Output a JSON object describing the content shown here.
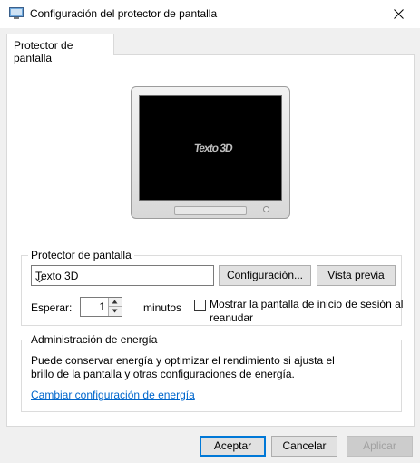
{
  "window": {
    "title": "Configuración del protector de pantalla"
  },
  "tabs": [
    {
      "label": "Protector de pantalla"
    }
  ],
  "preview": {
    "screen_text": "Texto 3D"
  },
  "screensaver_group": {
    "legend": "Protector de pantalla",
    "selected": "Texto 3D",
    "settings_label": "Configuración...",
    "preview_label": "Vista previa",
    "wait_label": "Esperar:",
    "wait_value": "1",
    "minutes_label": "minutos",
    "resume_checkbox_line1": "Mostrar la pantalla de inicio de sesión al",
    "resume_checkbox_line2": "reanudar",
    "resume_checked": false
  },
  "power_group": {
    "legend": "Administración de energía",
    "description_line1": "Puede conservar energía y optimizar el rendimiento si ajusta el",
    "description_line2": "brillo de la pantalla y otras configuraciones de energía.",
    "link_label": "Cambiar configuración de energía"
  },
  "footer": {
    "ok_label": "Aceptar",
    "cancel_label": "Cancelar",
    "apply_label": "Aplicar"
  },
  "colors": {
    "link": "#0066cc",
    "default_button_border": "#0078d7",
    "screen": "#000000"
  }
}
